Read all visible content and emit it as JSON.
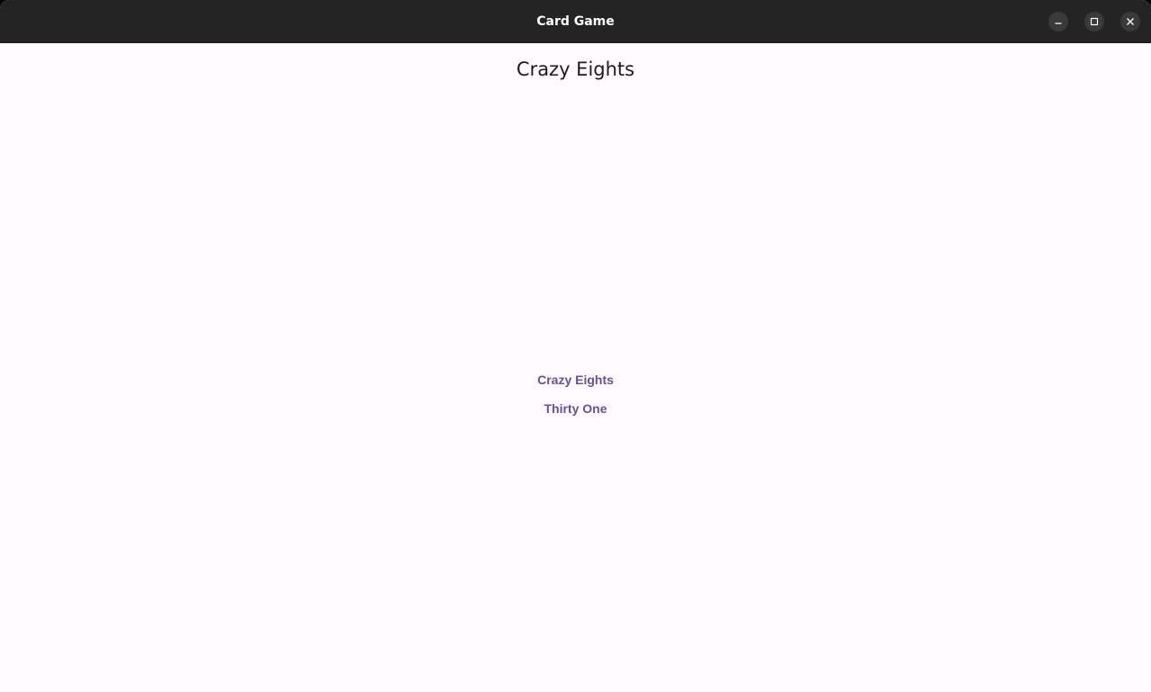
{
  "window": {
    "title": "Card Game"
  },
  "app": {
    "title": "Crazy Eights"
  },
  "menu": {
    "items": [
      {
        "label": "Crazy Eights"
      },
      {
        "label": "Thirty One"
      }
    ]
  },
  "colors": {
    "titlebar": "#242424",
    "background": "#fffbfe",
    "accent": "#6750a4",
    "text": "#1d1b20"
  },
  "icons": {
    "minimize": "minimize-icon",
    "maximize": "maximize-icon",
    "close": "close-icon"
  }
}
